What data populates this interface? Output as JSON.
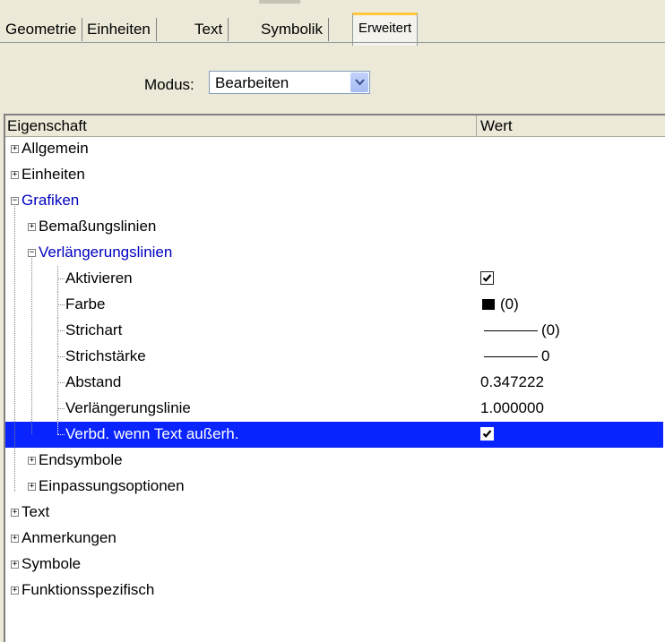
{
  "tabs": [
    "Geometrie",
    "Einheiten",
    "Text",
    "Symbolik",
    "Erweitert"
  ],
  "active_tab": "Erweitert",
  "modus": {
    "label": "Modus:",
    "value": "Bearbeiten"
  },
  "grid": {
    "col_property": "Eigenschaft",
    "col_value": "Wert",
    "rows": [
      {
        "label": "Allgemein",
        "level": 0,
        "state": "collapsed"
      },
      {
        "label": "Einheiten",
        "level": 0,
        "state": "collapsed"
      },
      {
        "label": "Grafiken",
        "level": 0,
        "state": "expanded"
      },
      {
        "label": "Bemaßungslinien",
        "level": 1,
        "state": "collapsed"
      },
      {
        "label": "Verlängerungslinien",
        "level": 1,
        "state": "expanded"
      },
      {
        "label": "Aktivieren",
        "level": 2,
        "value_type": "checkbox",
        "checked": true
      },
      {
        "label": "Farbe",
        "level": 2,
        "value_type": "color",
        "value": "(0)",
        "color": "#000000"
      },
      {
        "label": "Strichart",
        "level": 2,
        "value_type": "line",
        "value": "(0)"
      },
      {
        "label": "Strichstärke",
        "level": 2,
        "value_type": "line",
        "value": "0"
      },
      {
        "label": "Abstand",
        "level": 2,
        "value_type": "text",
        "value": "0.347222"
      },
      {
        "label": "Verlängerungslinie",
        "level": 2,
        "value_type": "text",
        "value": "1.000000"
      },
      {
        "label": "Verbd. wenn Text außerh.",
        "level": 2,
        "value_type": "checkbox",
        "checked": true,
        "selected": true
      },
      {
        "label": "Endsymbole",
        "level": 1,
        "state": "collapsed"
      },
      {
        "label": "Einpassungsoptionen",
        "level": 1,
        "state": "collapsed"
      },
      {
        "label": "Text",
        "level": 0,
        "state": "collapsed"
      },
      {
        "label": "Anmerkungen",
        "level": 0,
        "state": "collapsed"
      },
      {
        "label": "Symbole",
        "level": 0,
        "state": "collapsed"
      },
      {
        "label": "Funktionsspezifisch",
        "level": 0,
        "state": "collapsed"
      }
    ]
  },
  "colors": {
    "selection": "#0a24ff",
    "expanded_label": "#0000c0",
    "tab_highlight": "#ffc83c"
  }
}
